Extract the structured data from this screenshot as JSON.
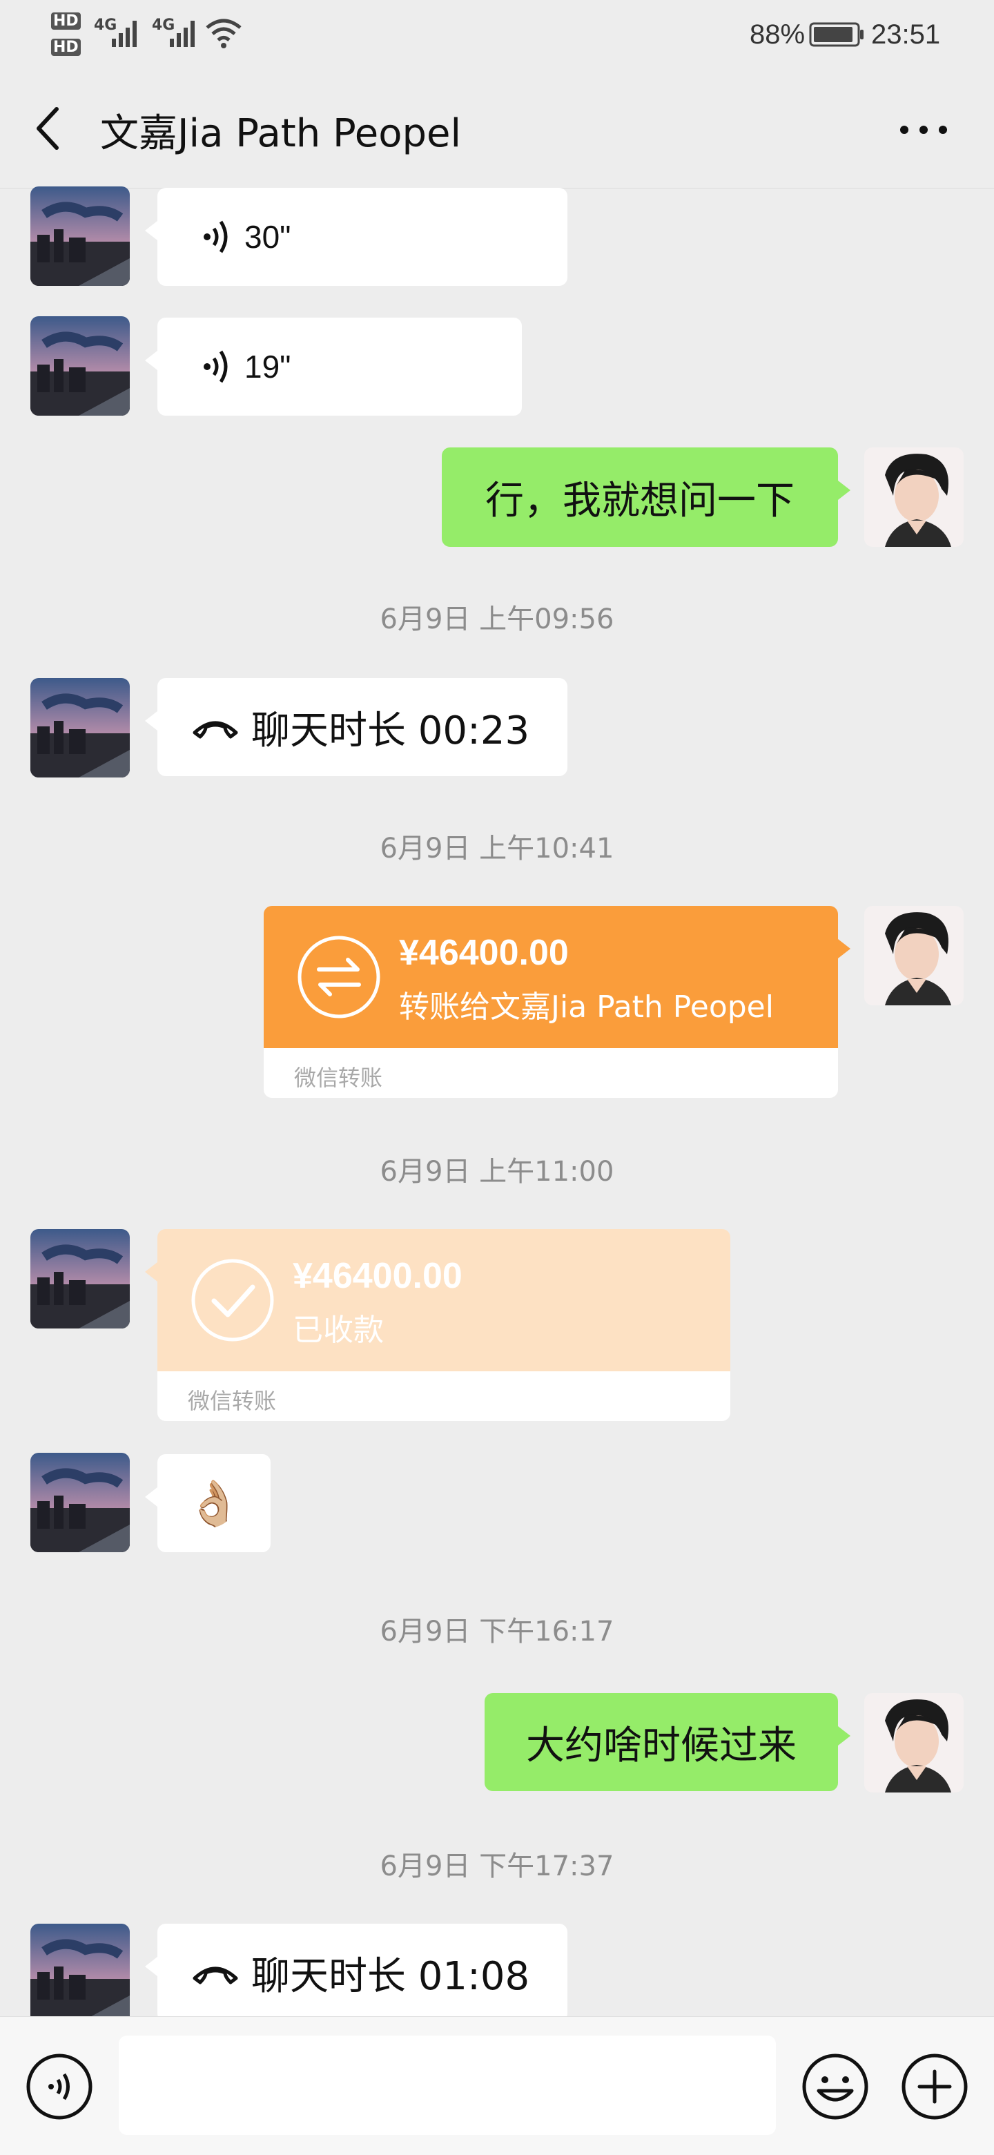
{
  "status_bar": {
    "hd1": "HD",
    "hd2": "HD",
    "net1": "4G",
    "net2": "4G",
    "battery": "88%",
    "time": "23:51"
  },
  "header": {
    "title": "文嘉Jia Path Peopel"
  },
  "messages": {
    "voice1_duration": "30\"",
    "voice2_duration": "19\"",
    "sent_text1": "行，我就想问一下",
    "ts1": "6月9日 上午09:56",
    "call1": "聊天时长 00:23",
    "ts2": "6月9日 上午10:41",
    "transfer_sent_amount": "¥46400.00",
    "transfer_sent_desc": "转账给文嘉Jia Path Peopel",
    "transfer_sent_footer": "微信转账",
    "ts3": "6月9日 上午11:00",
    "transfer_recv_amount": "¥46400.00",
    "transfer_recv_desc": "已收款",
    "transfer_recv_footer": "微信转账",
    "emoji": "👌🏼",
    "ts4": "6月9日 下午16:17",
    "sent_text2": "大约啥时候过来",
    "ts5": "6月9日 下午17:37",
    "call2": "聊天时长 01:08"
  },
  "input_bar": {
    "text_value": ""
  },
  "colors": {
    "background": "#ededed",
    "sent_bubble": "#95ec69",
    "transfer_orange": "#fa9d3b",
    "transfer_received": "#fde1c3"
  },
  "icons": {
    "back": "chevron-left-icon",
    "more": "more-dots-icon",
    "voice": "voice-wave-icon",
    "call": "phone-hangup-icon",
    "transfer": "transfer-arrows-icon",
    "received": "checkmark-circle-icon",
    "voice_input": "voice-input-icon",
    "emoji": "emoji-face-icon",
    "plus": "plus-circle-icon"
  }
}
